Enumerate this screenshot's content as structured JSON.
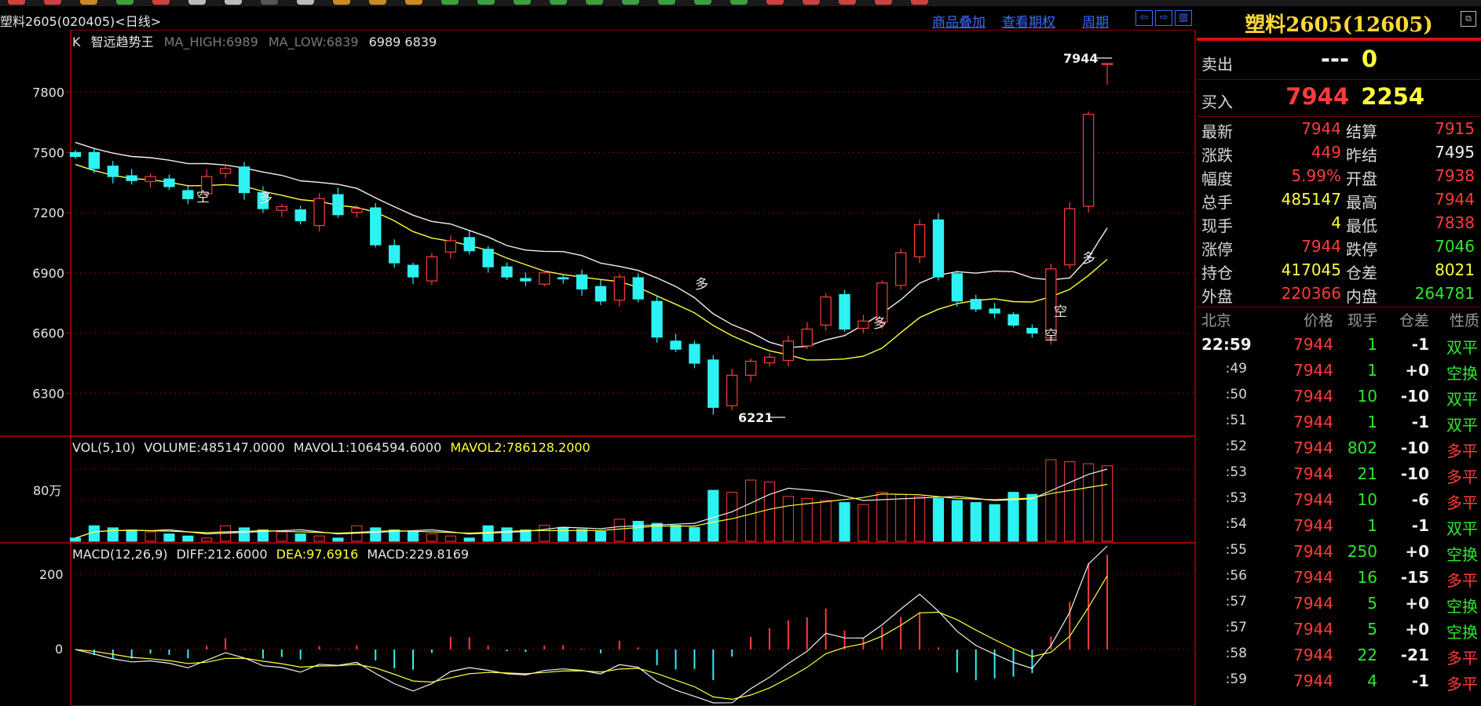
{
  "window": {
    "title": "塑料2605(020405)<日线>",
    "links": [
      "商品叠加",
      "查看期权",
      "周期"
    ],
    "nav_icons": [
      "scroll-left-icon",
      "scroll-right-icon",
      "layout-icon"
    ]
  },
  "colors": {
    "up": "#ff3b3b",
    "down": "#2ef2f2",
    "green": "#2ee82e",
    "yellow": "#ffff3a",
    "grid": "#8a0000",
    "link": "#3b6cff"
  },
  "kline": {
    "legend": {
      "prefix": "K",
      "name": "智远趋势王",
      "ma_high": "MA_HIGH:6989",
      "ma_low": "MA_LOW:6839",
      "values": "6989 6839"
    },
    "y_ticks": [
      7800,
      7500,
      7200,
      6900,
      6600,
      6300
    ],
    "y_range": [
      6110,
      8080
    ],
    "max_label": "7944",
    "min_label": "6221",
    "signals": [
      "空",
      "多",
      "空",
      "多",
      "多",
      "空",
      "多"
    ]
  },
  "volume": {
    "legend": {
      "label": "VOL(5,10)",
      "volume": "VOLUME:485147.0000",
      "mavol1": "MAVOL1:1064594.6000",
      "mavol2": "MAVOL2:786128.2000"
    },
    "y_tick": "80万"
  },
  "macd": {
    "legend": {
      "label": "MACD(12,26,9)",
      "diff": "DIFF:212.6000",
      "dea": "DEA:97.6916",
      "macd": "MACD:229.8169"
    },
    "y_ticks": [
      "200",
      "0"
    ]
  },
  "chart_data": {
    "type": "candlestick",
    "symbol": "塑料2605",
    "period": "日线",
    "approx_closes": [
      7480,
      7420,
      7380,
      7360,
      7380,
      7330,
      7270,
      7380,
      7420,
      7300,
      7220,
      7230,
      7160,
      7270,
      7190,
      7220,
      7040,
      6950,
      6880,
      6980,
      7060,
      7010,
      6930,
      6880,
      6860,
      6900,
      6870,
      6820,
      6760,
      6880,
      6770,
      6580,
      6520,
      6450,
      6230,
      6390,
      6460,
      6480,
      6560,
      6620,
      6780,
      6620,
      6660,
      6850,
      7000,
      7140,
      6880,
      6760,
      6720,
      6700,
      6640,
      6600,
      6920,
      7220,
      7690,
      7944
    ],
    "last": {
      "close": 7944,
      "high": 7944,
      "low": 7838,
      "open": 7938
    },
    "period_high": 7944,
    "period_low": 6221
  },
  "quote": {
    "name": "塑料2605(12605)",
    "restore_icon": "restore-window-icon",
    "sell": {
      "label": "卖出",
      "price": "---",
      "volume": "0"
    },
    "buy": {
      "label": "买入",
      "price": "7944",
      "volume": "2254"
    },
    "stats": [
      {
        "l1": "最新",
        "v1": "7944",
        "c1": "red",
        "l2": "结算",
        "v2": "7915",
        "c2": "red"
      },
      {
        "l1": "涨跌",
        "v1": "449",
        "c1": "red",
        "l2": "昨结",
        "v2": "7495",
        "c2": "wht"
      },
      {
        "l1": "幅度",
        "v1": "5.99%",
        "c1": "red",
        "l2": "开盘",
        "v2": "7938",
        "c2": "red"
      },
      {
        "l1": "总手",
        "v1": "485147",
        "c1": "yel",
        "l2": "最高",
        "v2": "7944",
        "c2": "red"
      },
      {
        "l1": "现手",
        "v1": "4",
        "c1": "yel",
        "l2": "最低",
        "v2": "7838",
        "c2": "red"
      },
      {
        "l1": "涨停",
        "v1": "7944",
        "c1": "red",
        "l2": "跌停",
        "v2": "7046",
        "c2": "grn"
      },
      {
        "l1": "持仓",
        "v1": "417045",
        "c1": "yel",
        "l2": "仓差",
        "v2": "8021",
        "c2": "yel"
      },
      {
        "l1": "外盘",
        "v1": "220366",
        "c1": "red",
        "l2": "内盘",
        "v2": "264781",
        "c2": "grn"
      }
    ],
    "ticks_header": [
      "北京",
      "价格",
      "现手",
      "仓差",
      "性质"
    ],
    "ticks": [
      {
        "time": "22:59",
        "price": "7944",
        "vol": "1",
        "oi": "-1",
        "type": "双平",
        "oi_color": "wht",
        "type_color": "grn"
      },
      {
        "time": ":49",
        "price": "7944",
        "vol": "1",
        "oi": "+0",
        "type": "空换",
        "oi_color": "wht",
        "type_color": "grn"
      },
      {
        "time": ":50",
        "price": "7944",
        "vol": "10",
        "oi": "-10",
        "type": "双平",
        "oi_color": "wht",
        "type_color": "grn"
      },
      {
        "time": ":51",
        "price": "7944",
        "vol": "1",
        "oi": "-1",
        "type": "双平",
        "oi_color": "wht",
        "type_color": "grn"
      },
      {
        "time": ":52",
        "price": "7944",
        "vol": "802",
        "oi": "-10",
        "type": "多平",
        "oi_color": "wht",
        "type_color": "red"
      },
      {
        "time": ":53",
        "price": "7944",
        "vol": "21",
        "oi": "-10",
        "type": "多平",
        "oi_color": "wht",
        "type_color": "red"
      },
      {
        "time": ":53",
        "price": "7944",
        "vol": "10",
        "oi": "-6",
        "type": "多平",
        "oi_color": "wht",
        "type_color": "red"
      },
      {
        "time": ":54",
        "price": "7944",
        "vol": "1",
        "oi": "-1",
        "type": "双平",
        "oi_color": "wht",
        "type_color": "grn"
      },
      {
        "time": ":55",
        "price": "7944",
        "vol": "250",
        "oi": "+0",
        "type": "空换",
        "oi_color": "wht",
        "type_color": "grn"
      },
      {
        "time": ":56",
        "price": "7944",
        "vol": "16",
        "oi": "-15",
        "type": "多平",
        "oi_color": "wht",
        "type_color": "red"
      },
      {
        "time": ":57",
        "price": "7944",
        "vol": "5",
        "oi": "+0",
        "type": "空换",
        "oi_color": "wht",
        "type_color": "grn"
      },
      {
        "time": ":57",
        "price": "7944",
        "vol": "5",
        "oi": "+0",
        "type": "空换",
        "oi_color": "wht",
        "type_color": "grn"
      },
      {
        "time": ":58",
        "price": "7944",
        "vol": "22",
        "oi": "-21",
        "type": "多平",
        "oi_color": "wht",
        "type_color": "red"
      },
      {
        "time": ":59",
        "price": "7944",
        "vol": "4",
        "oi": "-1",
        "type": "多平",
        "oi_color": "wht",
        "type_color": "red"
      }
    ]
  }
}
